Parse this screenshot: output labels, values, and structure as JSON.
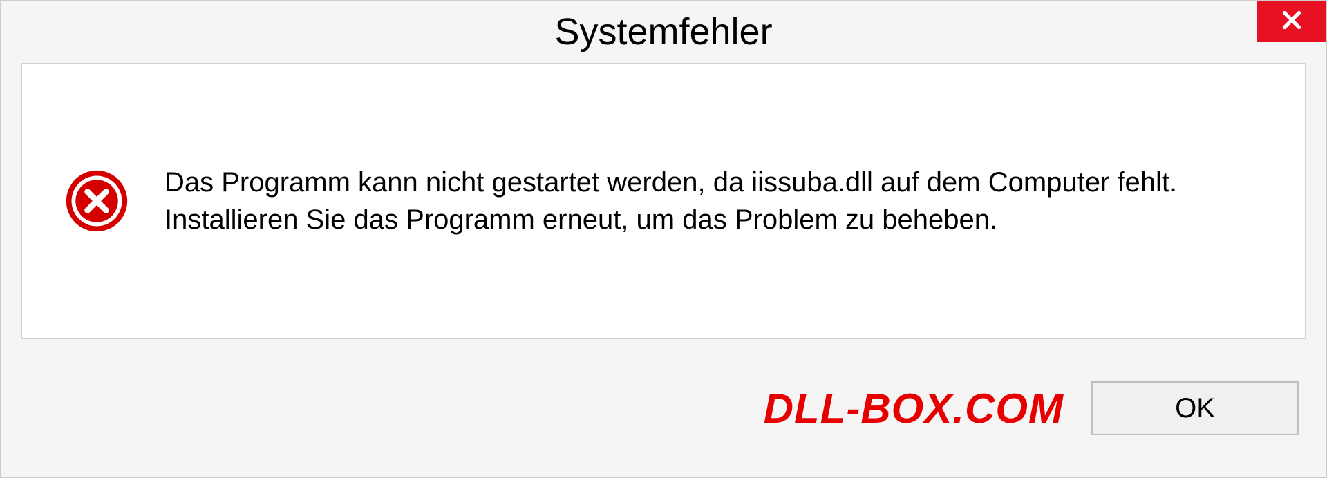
{
  "dialog": {
    "title": "Systemfehler",
    "message": "Das Programm kann nicht gestartet werden, da iissuba.dll auf dem Computer fehlt. Installieren Sie das Programm erneut, um das Problem zu beheben.",
    "ok_label": "OK"
  },
  "watermark": "DLL-BOX.COM",
  "colors": {
    "close_bg": "#e81123",
    "error_icon": "#d40000",
    "watermark": "#e60000"
  }
}
